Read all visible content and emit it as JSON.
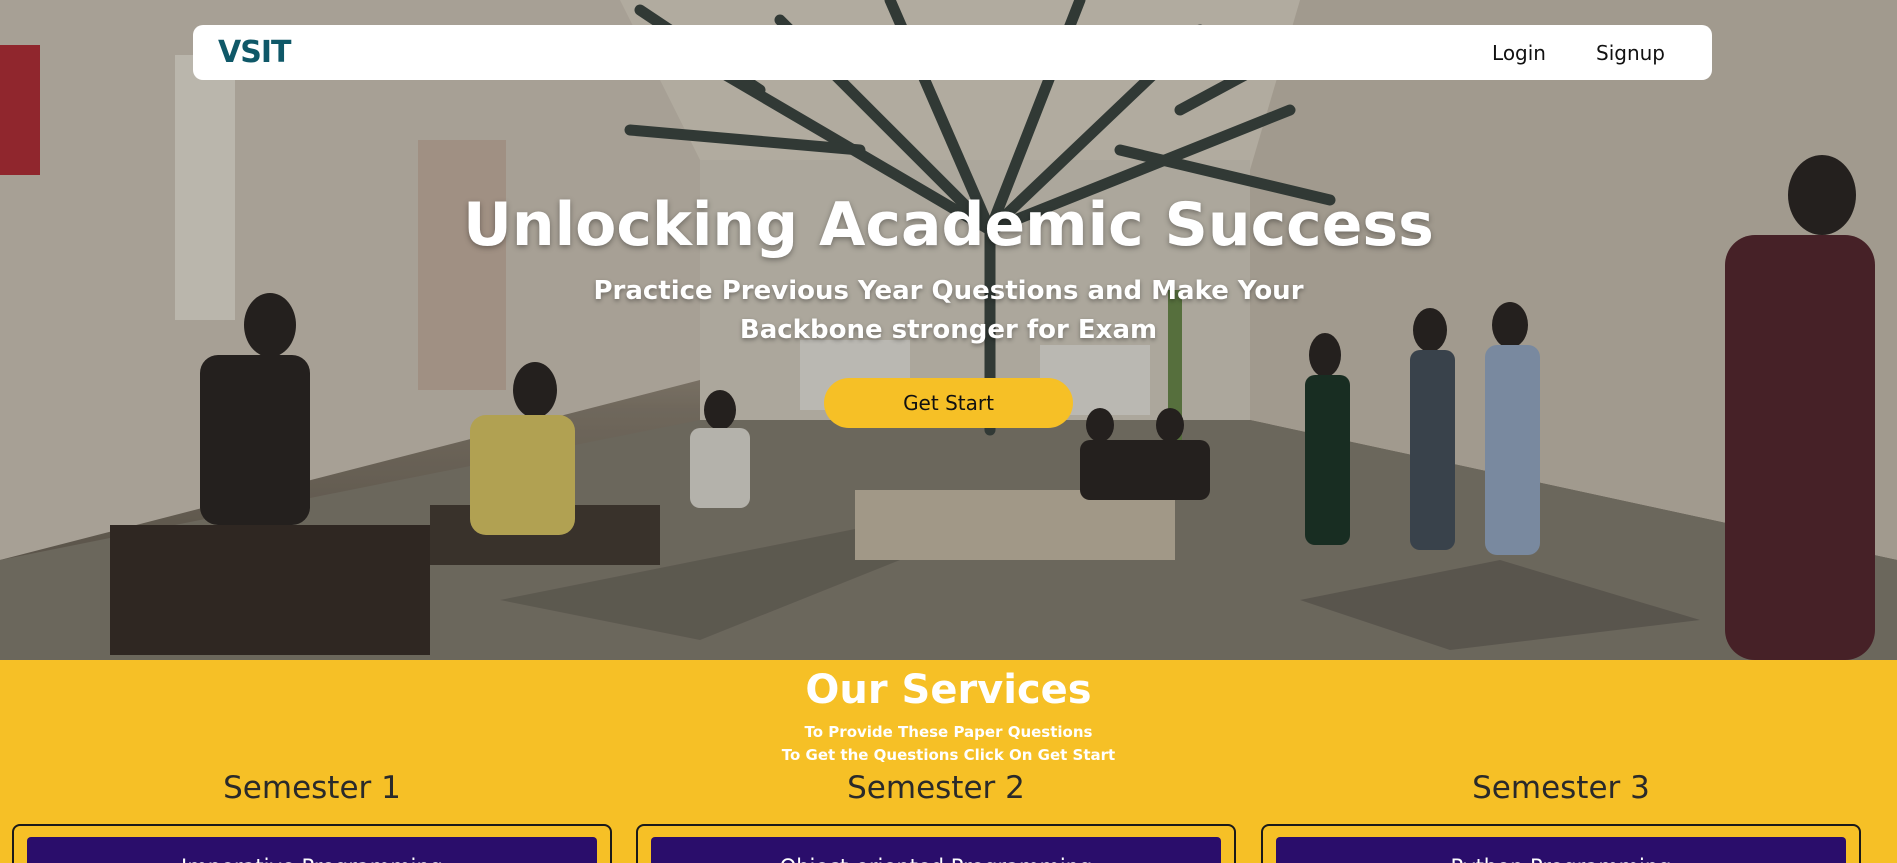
{
  "navbar": {
    "logo": "VSIT",
    "links": [
      "Login",
      "Signup"
    ]
  },
  "hero": {
    "title": "Unlocking Academic Success",
    "subtitle_line1": "Practice Previous Year Questions and Make Your",
    "subtitle_line2": "Backbone stronger for Exam",
    "cta_label": "Get Start"
  },
  "services": {
    "title": "Our Services",
    "subtitle_line1": "To Provide These Paper Questions",
    "subtitle_line2": "To Get the Questions Click On Get Start",
    "semesters": [
      {
        "title": "Semester 1",
        "course": "Imperative Programming"
      },
      {
        "title": "Semester 2",
        "course": "Object-oriented Programming"
      },
      {
        "title": "Semester 3",
        "course": "Python Programming"
      }
    ]
  },
  "colors": {
    "accent": "#f6c026",
    "logo": "#0f5868",
    "course_button": "#2a0d6b"
  }
}
